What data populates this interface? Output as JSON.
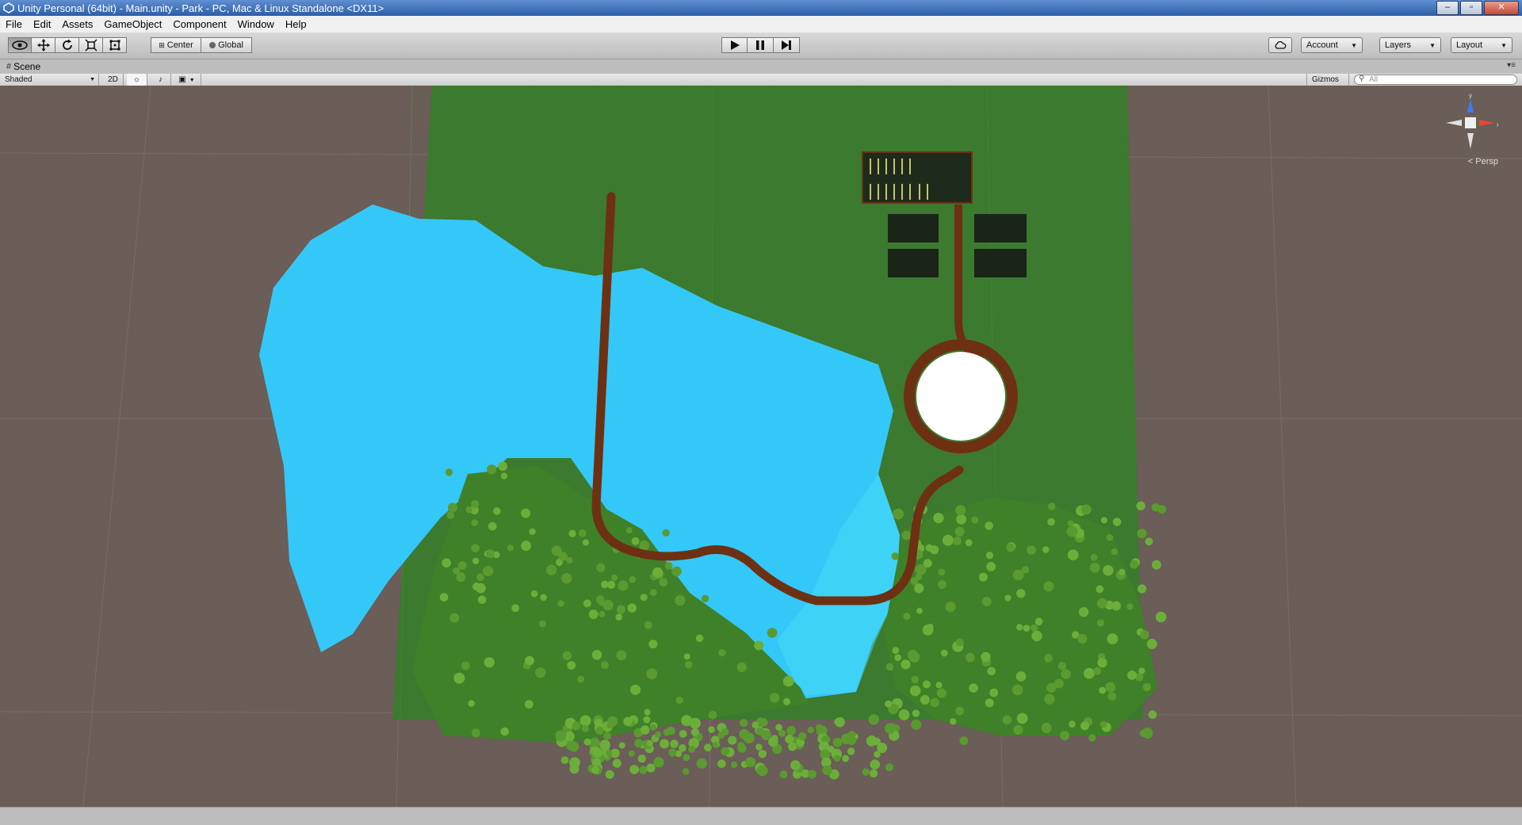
{
  "window": {
    "title": "Unity Personal (64bit) - Main.unity - Park - PC, Mac & Linux Standalone <DX11>",
    "controls": [
      "minimize-icon",
      "maximize-icon",
      "close-icon"
    ]
  },
  "menu": {
    "items": [
      "File",
      "Edit",
      "Assets",
      "GameObject",
      "Component",
      "Window",
      "Help"
    ]
  },
  "toolbar": {
    "tools": [
      "hand-tool-icon",
      "move-tool-icon",
      "rotate-tool-icon",
      "scale-tool-icon",
      "rect-tool-icon"
    ],
    "active_tool": "hand-tool-icon",
    "pivot_label": "Center",
    "space_label": "Global",
    "playback": [
      "play-icon",
      "pause-icon",
      "step-icon"
    ],
    "cloud_icon": "cloud-icon",
    "account_label": "Account",
    "layers_label": "Layers",
    "layout_label": "Layout"
  },
  "scene_tab": {
    "label": "Scene",
    "icon": "scene-hash-icon"
  },
  "scene_bar": {
    "draw_mode": "Shaded",
    "mode_2d": "2D",
    "icons": [
      "lighting-icon",
      "audio-icon",
      "image-effects-icon"
    ],
    "gizmos_label": "Gizmos",
    "search_placeholder": "All"
  },
  "scene_view": {
    "projection_label": "< Persp",
    "axis_labels": {
      "y": "y",
      "x": "x"
    },
    "colors": {
      "background": "#6b5d57",
      "grass": "#3c7a2f",
      "water": "#33c8f7",
      "path": "#6e3012",
      "tree": "#4a8a2a",
      "circle": "#ffffff"
    }
  }
}
